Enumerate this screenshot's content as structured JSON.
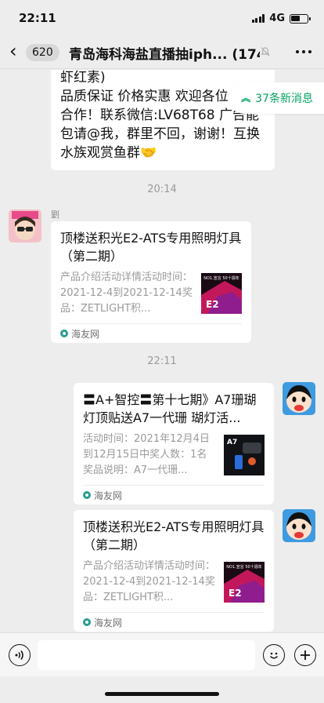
{
  "status": {
    "time": "22:11",
    "network": "4G"
  },
  "nav": {
    "unread_count": "620",
    "title": "青岛海科海盐直播抽iph...",
    "member_count": "(174)"
  },
  "messages": {
    "first_text": {
      "lines": [
        "虾红素)",
        "品质保证 价格实惠 欢迎各位老",
        "合作！联系微信:LV68T68 广告能",
        "包请@我，群里不回，谢谢！互换",
        "水族观赏鱼群🤝"
      ]
    },
    "new_messages": "37条新消息",
    "time1": "20:14",
    "sender1": "劉",
    "card1": {
      "title": "顶楼送积光E2-ATS专用照明灯具（第二期）",
      "desc": "产品介绍活动详情活动时间：2021-12-4到2021-12-14奖品：ZETLIGHT积...",
      "source": "海友网"
    },
    "time2": "22:11",
    "card2": {
      "title": "〓A+智控〓第十七期》A7珊瑚灯顶贴送A7一代珊 瑚灯活...",
      "desc": "活动时间：2021年12月4日到12月15日中奖人数：1名奖品说明：A7一代珊...",
      "source": "海友网"
    },
    "card3": {
      "title": "顶楼送积光E2-ATS专用照明灯具（第二期）",
      "desc": "产品介绍活动详情活动时间：2021-12-4到2021-12-14奖品：ZETLIGHT积...",
      "source": "海友网"
    }
  },
  "thumbs": {
    "e2_top": "NO1.宣言 50十週年",
    "e2_big": "E2",
    "a7": "A7"
  },
  "colors": {
    "accent_green": "#07a363",
    "background": "#ededed"
  }
}
